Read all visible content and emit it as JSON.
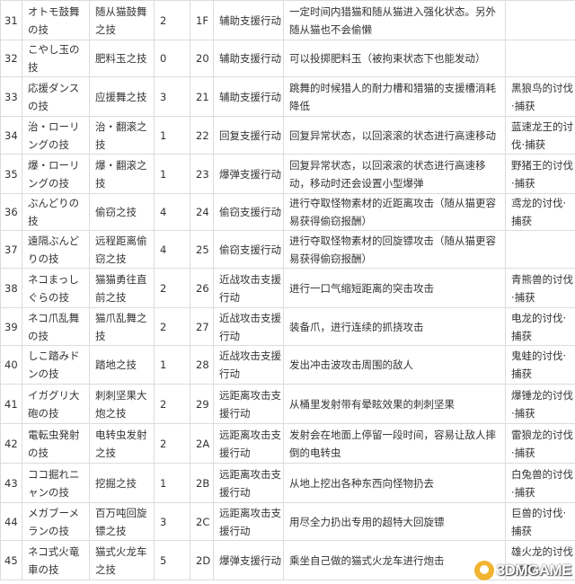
{
  "rows": [
    {
      "no": "31",
      "name_jp": "オトモ鼓舞の技",
      "name_cn": "随从猫鼓舞之技",
      "cost": "2",
      "code": "1F",
      "type": "辅助支援行动",
      "desc": "一定时间内猎猫和随从猫进入强化状态。另外随从猫也不会偷懒",
      "unlock": ""
    },
    {
      "no": "32",
      "name_jp": "こやし玉の技",
      "name_cn": "肥料玉之技",
      "cost": "0",
      "code": "20",
      "type": "辅助支援行动",
      "desc": "可以投掷肥料玉（被拘束状态下也能发动）",
      "unlock": ""
    },
    {
      "no": "33",
      "name_jp": "応援ダンスの技",
      "name_cn": "应援舞之技",
      "cost": "3",
      "code": "21",
      "type": "辅助支援行动",
      "desc": "跳舞的时候猎人的耐力槽和猎猫的支援槽消耗降低",
      "unlock": "黑狼鸟的讨伐·捕获"
    },
    {
      "no": "34",
      "name_jp": "治・ローリングの技",
      "name_cn": "治・翻滚之技",
      "cost": "1",
      "code": "22",
      "type": "回复支援行动",
      "desc": "回复异常状态，以回滚滚的状态进行高速移动",
      "unlock": "蓝速龙王的讨伐·捕获"
    },
    {
      "no": "35",
      "name_jp": "爆・ローリングの技",
      "name_cn": "爆・翻滚之技",
      "cost": "1",
      "code": "23",
      "type": "爆弹支援行动",
      "desc": "回复异常状态，以回滚滚的状态进行高速移动，移动时还会设置小型爆弹",
      "unlock": "野猪王的讨伐·捕获"
    },
    {
      "no": "36",
      "name_jp": "ぶんどりの技",
      "name_cn": "偷窃之技",
      "cost": "4",
      "code": "24",
      "type": "偷窃支援行动",
      "desc": "进行夺取怪物素材的近距离攻击（随从猫更容易获得偷窃报酬）",
      "unlock": "鸢龙的讨伐·捕获"
    },
    {
      "no": "37",
      "name_jp": "遠隔ぶんどりの技",
      "name_cn": "远程距离偷窃之技",
      "cost": "4",
      "code": "25",
      "type": "偷窃支援行动",
      "desc": "进行夺取怪物素材的回旋镖攻击（随从猫更容易获得偷窃报酬）",
      "unlock": ""
    },
    {
      "no": "38",
      "name_jp": "ネコまっしぐらの技",
      "name_cn": "猫猫勇往直前之技",
      "cost": "2",
      "code": "26",
      "type": "近战攻击支援行动",
      "desc": "进行一口气缩短距离的突击攻击",
      "unlock": "青熊兽的讨伐·捕获"
    },
    {
      "no": "39",
      "name_jp": "ネコ爪乱舞の技",
      "name_cn": "猫爪乱舞之技",
      "cost": "2",
      "code": "27",
      "type": "近战攻击支援行动",
      "desc": "装备爪，进行连续的抓挠攻击",
      "unlock": "电龙的讨伐·捕获"
    },
    {
      "no": "40",
      "name_jp": "しこ踏みドンの技",
      "name_cn": "踏地之技",
      "cost": "1",
      "code": "28",
      "type": "近战攻击支援行动",
      "desc": "发出冲击波攻击周围的敌人",
      "unlock": "鬼蛙的讨伐·捕获"
    },
    {
      "no": "41",
      "name_jp": "イガグリ大砲の技",
      "name_cn": "刺刺坚果大炮之技",
      "cost": "2",
      "code": "29",
      "type": "远距离攻击支援行动",
      "desc": "从桶里发射带有晕眩效果的刺刺坚果",
      "unlock": "爆锤龙的讨伐·捕获"
    },
    {
      "no": "42",
      "name_jp": "電転虫発射の技",
      "name_cn": "电转虫发射之技",
      "cost": "2",
      "code": "2A",
      "type": "远距离攻击支援行动",
      "desc": "发射会在地面上停留一段时间，容易让敌人摔倒的电转虫",
      "unlock": "雷狼龙的讨伐·捕获"
    },
    {
      "no": "43",
      "name_jp": "ココ掘れニャンの技",
      "name_cn": "挖掘之技",
      "cost": "1",
      "code": "2B",
      "type": "远距离攻击支援行动",
      "desc": "从地上挖出各种东西向怪物扔去",
      "unlock": "白兔兽的讨伐·捕获"
    },
    {
      "no": "44",
      "name_jp": "メガブーメランの技",
      "name_cn": "百万吨回旋镖之技",
      "cost": "3",
      "code": "2C",
      "type": "远距离攻击支援行动",
      "desc": "用尽全力扔出专用的超特大回旋镖",
      "unlock": "巨兽的讨伐·捕获"
    },
    {
      "no": "45",
      "name_jp": "ネコ式火竜車の技",
      "name_cn": "猫式火龙车之技",
      "cost": "5",
      "code": "2D",
      "type": "爆弹支援行动",
      "desc": "乘坐自己做的猫式火龙车进行炮击",
      "unlock": "雄火龙的讨伐·捕获"
    }
  ],
  "watermark": {
    "text": "3DMGAME"
  }
}
